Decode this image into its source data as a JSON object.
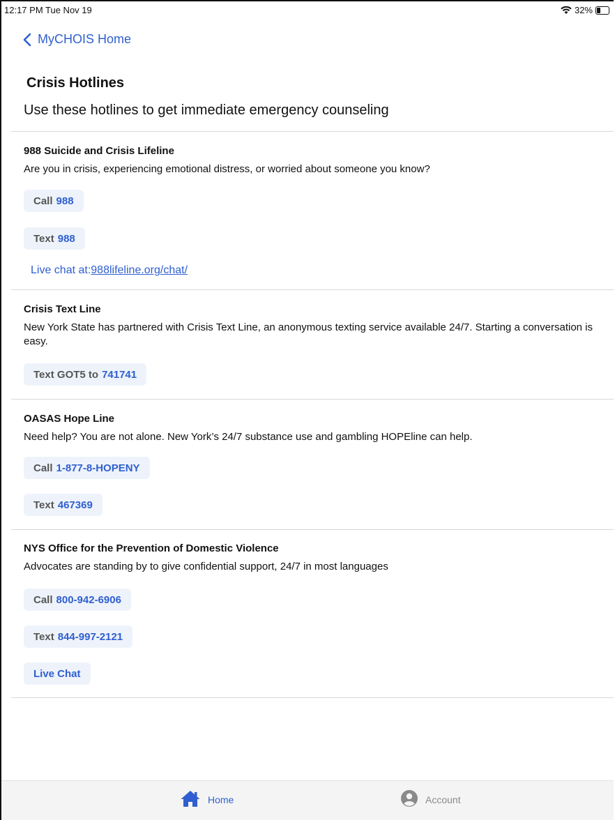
{
  "status_bar": {
    "time": "12:17 PM  Tue Nov 19",
    "battery": "32%"
  },
  "nav": {
    "back_label": "MyCHOIS Home"
  },
  "page": {
    "title": "Crisis Hotlines",
    "subtitle": "Use these hotlines to get immediate emergency counseling"
  },
  "sections": [
    {
      "title": "988 Suicide and Crisis Lifeline",
      "description": "Are you in crisis, experiencing emotional distress, or worried about someone you know?",
      "actions": [
        {
          "action": "Call",
          "value": "988"
        },
        {
          "action": "Text",
          "value": "988"
        }
      ],
      "live_chat_prefix": "Live chat at:",
      "live_chat_url": "988lifeline.org/chat/"
    },
    {
      "title": "Crisis Text Line",
      "description": "New York State has partnered with Crisis Text Line, an anonymous texting service available 24/7. Starting a conversation is easy.",
      "actions": [
        {
          "action": "Text GOT5 to",
          "value": "741741"
        }
      ]
    },
    {
      "title": "OASAS Hope Line",
      "description": "Need help? You are not alone. New York’s 24/7 substance use and gambling HOPEline can help.",
      "actions": [
        {
          "action": "Call",
          "value": "1-877-8-HOPENY"
        },
        {
          "action": "Text",
          "value": "467369"
        }
      ]
    },
    {
      "title": "NYS Office for the Prevention of Domestic Violence",
      "description": "Advocates are standing by to give confidential support, 24/7 in most languages",
      "actions": [
        {
          "action": "Call",
          "value": "800-942-6906"
        },
        {
          "action": "Text",
          "value": "844-997-2121"
        }
      ],
      "live_chat_button": "Live Chat"
    }
  ],
  "tab_bar": {
    "tabs": [
      {
        "label": "Home",
        "icon": "home-icon",
        "active": true
      },
      {
        "label": "Account",
        "icon": "account-icon",
        "active": false
      }
    ]
  },
  "colors": {
    "accent": "#2f5fd0",
    "pill_bg": "#eef3fb",
    "divider": "#d8d8d8"
  }
}
